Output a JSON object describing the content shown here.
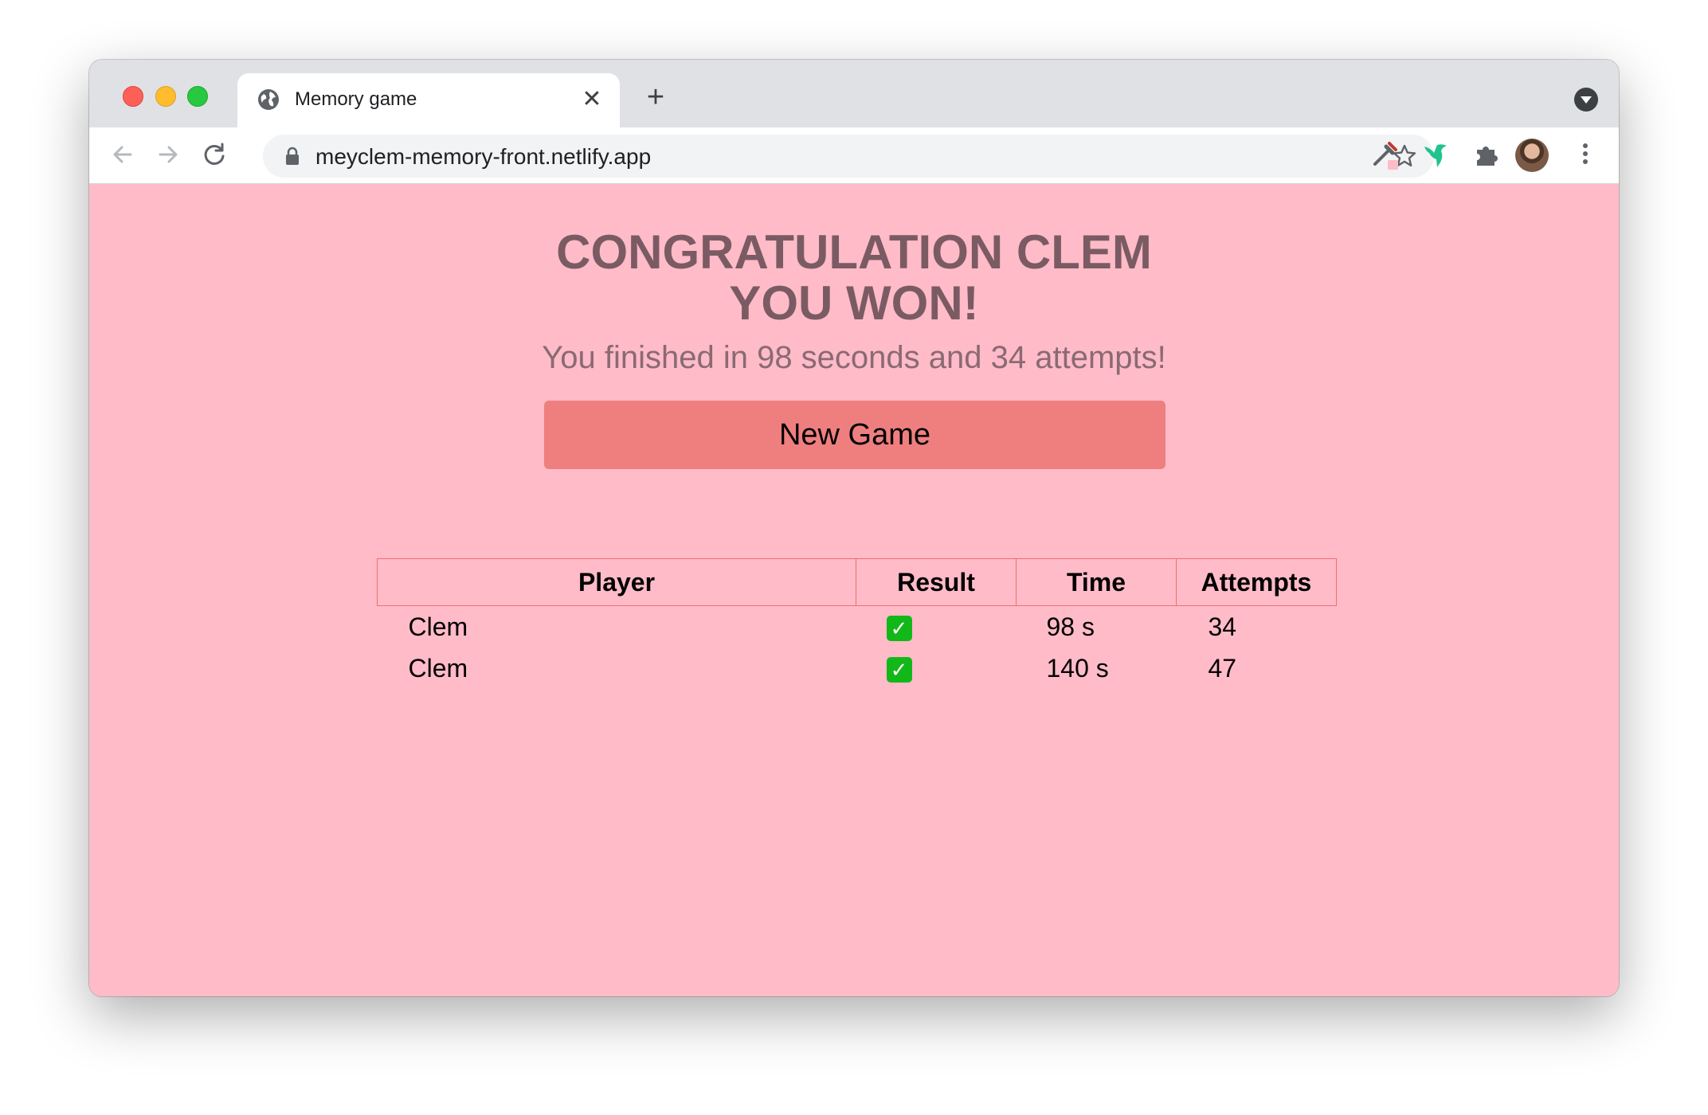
{
  "browser": {
    "tab_title": "Memory game",
    "tab_close_label": "✕",
    "new_tab_label": "+",
    "url": "meyclem-memory-front.netlify.app"
  },
  "game": {
    "headline_line1": "CONGRATULATION CLEM",
    "headline_line2": "YOU WON!",
    "summary": "You finished in 98 seconds and 34 attempts!",
    "new_game_label": "New Game"
  },
  "scores": {
    "headers": [
      "Player",
      "Result",
      "Time",
      "Attempts"
    ],
    "rows": [
      {
        "player": "Clem",
        "result": "✓",
        "time": "98 s",
        "attempts": "34"
      },
      {
        "player": "Clem",
        "result": "✓",
        "time": "140 s",
        "attempts": "47"
      }
    ]
  },
  "colors": {
    "page_background": "#ffbbc8",
    "button_background": "#ef7f7f",
    "headline_color": "#7b5b63",
    "table_border": "#ef6f6f",
    "check_color": "#12b818"
  }
}
